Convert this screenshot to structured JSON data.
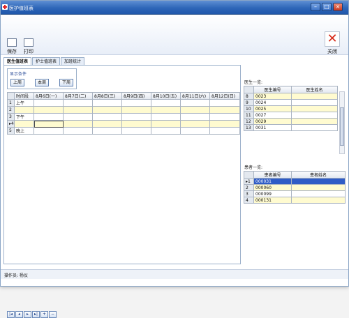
{
  "window": {
    "title": "医护值班表"
  },
  "toolbar": {
    "save_label": "保存",
    "print_label": "打印",
    "close_label": "关闭"
  },
  "tabs": [
    "医生值班表",
    "护士值班表",
    "加班统计"
  ],
  "filter": {
    "label": "显示条件",
    "prev": "上周",
    "current": "本周",
    "next": "下周"
  },
  "schedule": {
    "headers": [
      "时间段",
      "8月6日(一)",
      "8月7日(二)",
      "8月8日(三)",
      "8月9日(四)",
      "8月10日(五)",
      "8月11日(六)",
      "8月12日(日)"
    ],
    "rows": [
      {
        "num": "1",
        "period": "上午"
      },
      {
        "num": "2",
        "period": ""
      },
      {
        "num": "3",
        "period": "下午"
      },
      {
        "num": "4",
        "period": ""
      },
      {
        "num": "5",
        "period": "晚上"
      }
    ]
  },
  "doctors": {
    "label": "医生一览:",
    "headers": [
      "医生编号",
      "医生姓名"
    ],
    "rows": [
      {
        "num": "8",
        "id": "0023"
      },
      {
        "num": "9",
        "id": "0024"
      },
      {
        "num": "10",
        "id": "0025"
      },
      {
        "num": "11",
        "id": "0027"
      },
      {
        "num": "12",
        "id": "0029"
      },
      {
        "num": "13",
        "id": "0031"
      }
    ]
  },
  "patients": {
    "label": "患者一览:",
    "headers": [
      "患者编号",
      "患者姓名"
    ],
    "rows": [
      {
        "num": "1",
        "id": "000031"
      },
      {
        "num": "2",
        "id": "000060"
      },
      {
        "num": "3",
        "id": "000099"
      },
      {
        "num": "4",
        "id": "000131"
      }
    ]
  },
  "status": {
    "text": "操作员: 杨仪"
  },
  "colors": {
    "title_bar": "#2e66b8",
    "row_highlight": "#fffbd0",
    "selection": "#2f5cc6"
  }
}
